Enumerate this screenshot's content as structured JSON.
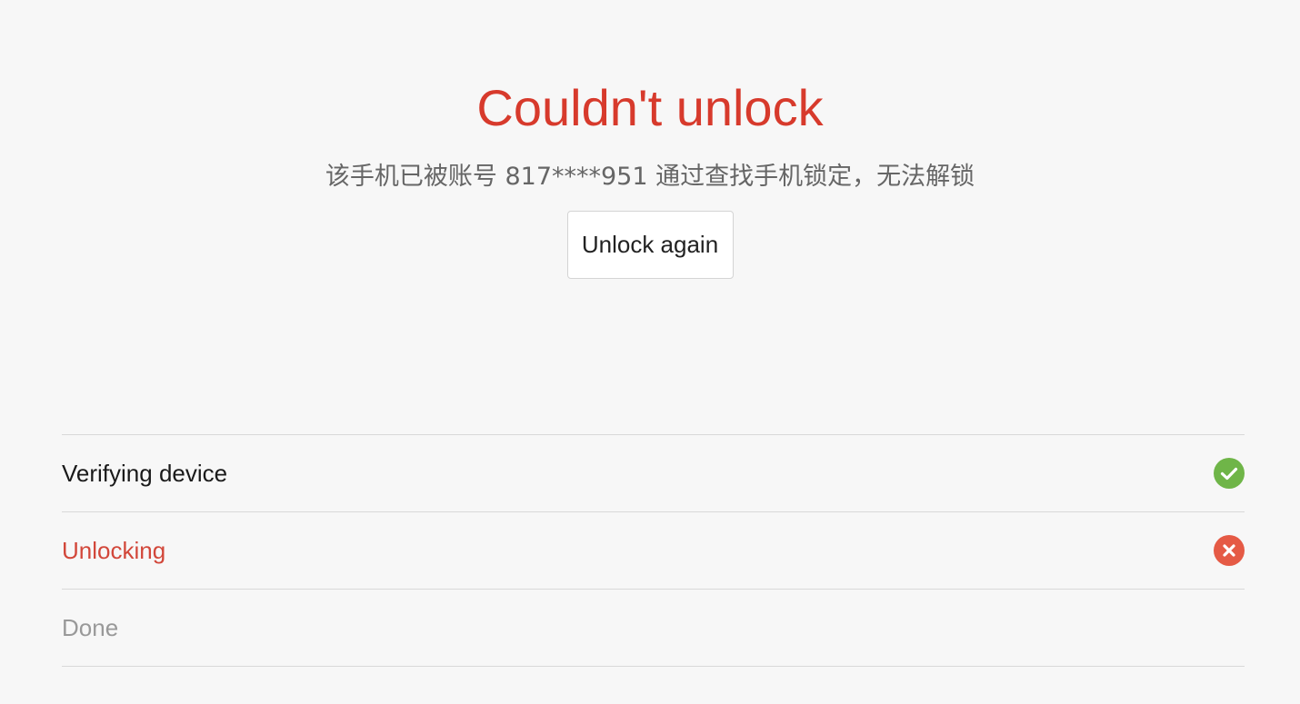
{
  "title": "Couldn't unlock",
  "message": "该手机已被账号 817****951 通过查找手机锁定，无法解锁",
  "unlock_button_label": "Unlock again",
  "steps": [
    {
      "label": "Verifying device",
      "status": "success",
      "icon": "check-circle-icon"
    },
    {
      "label": "Unlocking",
      "status": "failed",
      "icon": "x-circle-icon"
    },
    {
      "label": "Done",
      "status": "pending",
      "icon": ""
    }
  ],
  "colors": {
    "error_red": "#d73a2c",
    "success_green": "#6fb548",
    "failed_icon_red": "#e55a45"
  }
}
